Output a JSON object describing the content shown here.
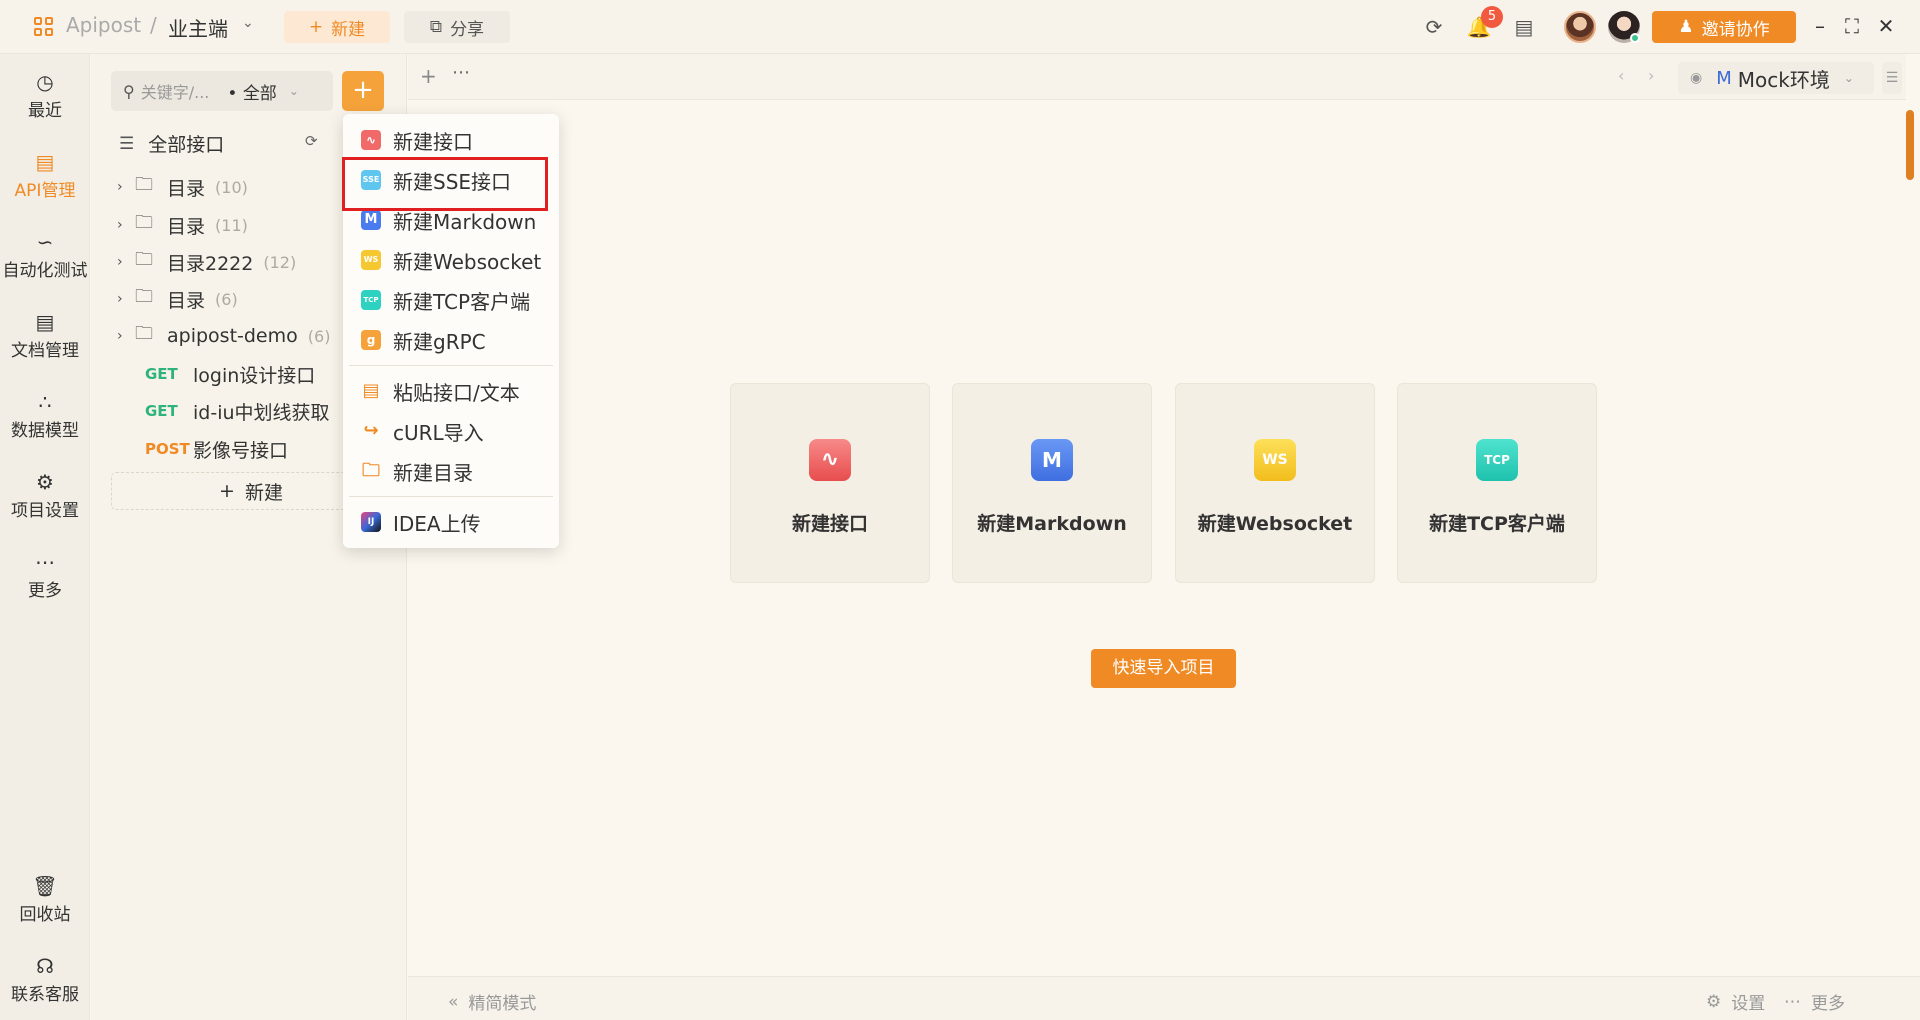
{
  "app": {
    "name": "Apipost",
    "separator": "/",
    "project": "业主端",
    "new_label": "新建",
    "share_label": "分享",
    "notification_count": "5",
    "invite_label": "邀请协作",
    "accent_color": "#f08a24"
  },
  "nav": {
    "items": [
      {
        "label": "最近",
        "icon": "clock-icon"
      },
      {
        "label": "API管理",
        "icon": "api-icon"
      },
      {
        "label": "自动化测试",
        "icon": "flow-icon"
      },
      {
        "label": "文档管理",
        "icon": "document-icon"
      },
      {
        "label": "数据模型",
        "icon": "model-icon"
      },
      {
        "label": "项目设置",
        "icon": "settings-icon"
      },
      {
        "label": "更多",
        "icon": "more-icon"
      }
    ],
    "bottom": [
      {
        "label": "回收站",
        "icon": "trash-icon"
      },
      {
        "label": "联系客服",
        "icon": "headset-icon"
      }
    ]
  },
  "tree": {
    "search_placeholder": "关键字/...",
    "filter": "全部",
    "header": "全部接口",
    "rows": [
      {
        "type": "folder",
        "name": "目录",
        "count": "(10)"
      },
      {
        "type": "folder",
        "name": "目录",
        "count": "(11)"
      },
      {
        "type": "folder",
        "name": "目录2222",
        "count": "(12)"
      },
      {
        "type": "folder",
        "name": "目录",
        "count": "(6)"
      },
      {
        "type": "folder",
        "name": "apipost-demo",
        "count": "(6)"
      },
      {
        "type": "api",
        "method": "GET",
        "name": "login设计接口"
      },
      {
        "type": "api",
        "method": "GET",
        "name": "id-iu中划线获取"
      },
      {
        "type": "api",
        "method": "POST",
        "name": "影像号接口"
      }
    ],
    "new_label": "新建"
  },
  "menu": {
    "items": [
      {
        "label": "新建接口",
        "icon": "http-icon",
        "color": "#f06a6a"
      },
      {
        "label": "新建SSE接口",
        "icon": "sse-icon",
        "color": "#5fc6f0"
      },
      {
        "label": "新建Markdown",
        "icon": "markdown-icon",
        "color": "#4a7cf0"
      },
      {
        "label": "新建Websocket",
        "icon": "websocket-icon",
        "color": "#f5c832"
      },
      {
        "label": "新建TCP客户端",
        "icon": "tcp-icon",
        "color": "#2fd1c0"
      },
      {
        "label": "新建gRPC",
        "icon": "grpc-icon",
        "color": "#f5a23a"
      },
      {
        "label": "粘贴接口/文本",
        "icon": "paste-icon"
      },
      {
        "label": "cURL导入",
        "icon": "curl-import-icon"
      },
      {
        "label": "新建目录",
        "icon": "new-folder-icon"
      },
      {
        "label": "IDEA上传",
        "icon": "idea-icon"
      }
    ],
    "icon_text": {
      "sse": "SSE",
      "markdown": "M",
      "websocket": "WS",
      "tcp": "TCP",
      "grpc": "g"
    }
  },
  "tabs": {
    "env_prefix": "M",
    "env_label": "Mock环境"
  },
  "main": {
    "cards": [
      {
        "label": "新建接口",
        "icon": "http-icon",
        "icon_text": ""
      },
      {
        "label": "新建Markdown",
        "icon": "markdown-icon",
        "icon_text": "M"
      },
      {
        "label": "新建Websocket",
        "icon": "websocket-icon",
        "icon_text": "WS"
      },
      {
        "label": "新建TCP客户端",
        "icon": "tcp-icon",
        "icon_text": "TCP"
      }
    ],
    "import_label": "快速导入项目"
  },
  "bottom": {
    "simple_mode": "精简模式",
    "settings": "设置",
    "more": "更多"
  }
}
